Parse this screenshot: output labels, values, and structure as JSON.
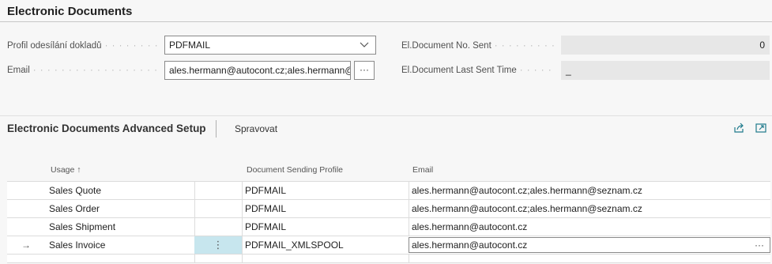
{
  "group": {
    "title": "Electronic Documents"
  },
  "fields": {
    "profile_label": "Profil odesílání dokladů",
    "profile_value": "PDFMAIL",
    "email_label": "Email",
    "email_value": "ales.hermann@autocont.cz;ales.hermann@",
    "email_assist": "···",
    "docno_label": "El.Document No. Sent",
    "docno_value": "0",
    "lastsent_label": "El.Document Last Sent Time",
    "lastsent_value": "_"
  },
  "part": {
    "title": "Electronic Documents Advanced Setup",
    "action": "Spravovat"
  },
  "grid": {
    "headers": {
      "usage": "Usage ↑",
      "profile": "Document Sending Profile",
      "email": "Email"
    },
    "rows": [
      {
        "usage": "Sales Quote",
        "profile": "PDFMAIL",
        "email": "ales.hermann@autocont.cz;ales.hermann@seznam.cz"
      },
      {
        "usage": "Sales Order",
        "profile": "PDFMAIL",
        "email": "ales.hermann@autocont.cz;ales.hermann@seznam.cz"
      },
      {
        "usage": "Sales Shipment",
        "profile": "PDFMAIL",
        "email": "ales.hermann@autocont.cz"
      },
      {
        "usage": "Sales Invoice",
        "profile": "PDFMAIL_XMLSPOOL",
        "email": "ales.hermann@autocont.cz",
        "indicator": "→",
        "menu": "⋮",
        "assist": "···"
      }
    ]
  },
  "colors": {
    "selection": "#c7e6ee",
    "readonly": "#e7e7e7"
  }
}
